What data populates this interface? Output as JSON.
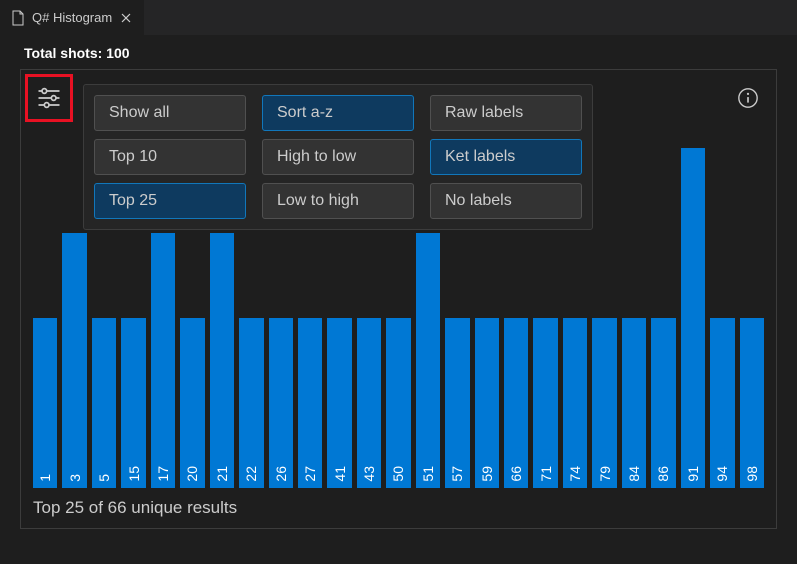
{
  "tab": {
    "title": "Q# Histogram"
  },
  "header": {
    "total_shots": "Total shots: 100"
  },
  "filters": {
    "show": [
      {
        "label": "Show all",
        "active": false
      },
      {
        "label": "Top 10",
        "active": false
      },
      {
        "label": "Top 25",
        "active": true
      }
    ],
    "sort": [
      {
        "label": "Sort a-z",
        "active": true
      },
      {
        "label": "High to low",
        "active": false
      },
      {
        "label": "Low to high",
        "active": false
      }
    ],
    "labels": [
      {
        "label": "Raw labels",
        "active": false
      },
      {
        "label": "Ket labels",
        "active": true
      },
      {
        "label": "No labels",
        "active": false
      }
    ]
  },
  "footer": {
    "summary": "Top 25 of 66 unique results"
  },
  "chart_data": {
    "type": "bar",
    "title": "",
    "xlabel": "",
    "ylabel": "",
    "ylim": [
      0,
      4
    ],
    "categories": [
      "1",
      "3",
      "5",
      "15",
      "17",
      "20",
      "21",
      "22",
      "26",
      "27",
      "41",
      "43",
      "50",
      "51",
      "57",
      "59",
      "66",
      "71",
      "74",
      "79",
      "84",
      "86",
      "91",
      "94",
      "98"
    ],
    "values": [
      2,
      3,
      2,
      2,
      3,
      2,
      3,
      2,
      2,
      2,
      2,
      2,
      2,
      3,
      2,
      2,
      2,
      2,
      2,
      2,
      2,
      2,
      4,
      2,
      2
    ]
  }
}
